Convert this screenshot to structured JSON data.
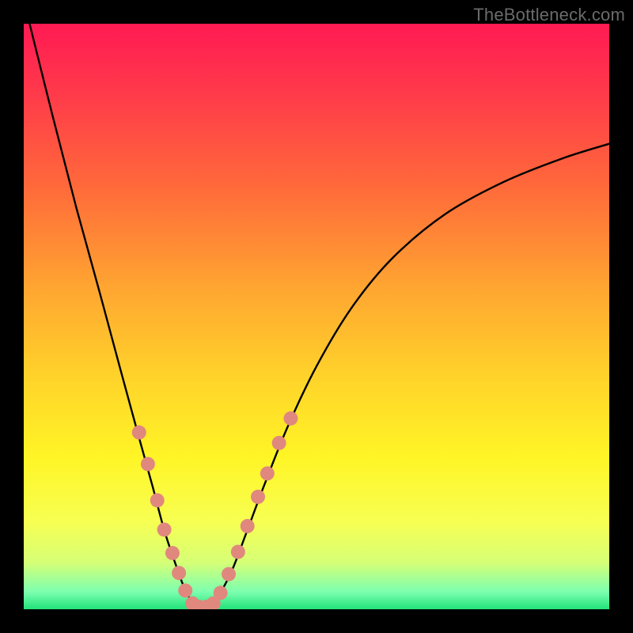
{
  "watermark": {
    "text": "TheBottleneck.com"
  },
  "chart_data": {
    "type": "line",
    "title": "",
    "xlabel": "",
    "ylabel": "",
    "xlim": [
      0,
      100
    ],
    "ylim": [
      0,
      100
    ],
    "grid": false,
    "legend": false,
    "gradient_stops": [
      {
        "offset": 0.0,
        "color": "#ff1a53"
      },
      {
        "offset": 0.12,
        "color": "#ff3a4a"
      },
      {
        "offset": 0.28,
        "color": "#ff6a3a"
      },
      {
        "offset": 0.45,
        "color": "#ffa531"
      },
      {
        "offset": 0.6,
        "color": "#ffd22a"
      },
      {
        "offset": 0.74,
        "color": "#fff526"
      },
      {
        "offset": 0.85,
        "color": "#f7ff52"
      },
      {
        "offset": 0.92,
        "color": "#d6ff76"
      },
      {
        "offset": 0.97,
        "color": "#7dffb0"
      },
      {
        "offset": 1.0,
        "color": "#22e27a"
      }
    ],
    "series": [
      {
        "name": "bottleneck-curve",
        "x": [
          1.0,
          5.0,
          9.0,
          13.0,
          16.5,
          19.5,
          22.0,
          24.0,
          26.0,
          27.5,
          29.2,
          30.8,
          33.0,
          35.5,
          38.0,
          41.0,
          45.0,
          50.0,
          56.0,
          63.0,
          72.0,
          82.0,
          92.0,
          100.0
        ],
        "values": [
          100.0,
          84.0,
          68.5,
          54.0,
          41.0,
          30.0,
          21.0,
          13.5,
          7.5,
          3.5,
          0.7,
          0.4,
          2.0,
          6.5,
          13.0,
          21.0,
          31.0,
          41.5,
          51.5,
          60.0,
          67.5,
          73.0,
          77.0,
          79.5
        ]
      }
    ],
    "scatter": {
      "name": "highlight-points",
      "color": "#e0887e",
      "radius": 9,
      "points": [
        {
          "x": 19.7,
          "y": 30.2
        },
        {
          "x": 21.2,
          "y": 24.8
        },
        {
          "x": 22.8,
          "y": 18.6
        },
        {
          "x": 24.0,
          "y": 13.6
        },
        {
          "x": 25.4,
          "y": 9.6
        },
        {
          "x": 26.5,
          "y": 6.2
        },
        {
          "x": 27.6,
          "y": 3.2
        },
        {
          "x": 28.8,
          "y": 1.0
        },
        {
          "x": 30.0,
          "y": 0.4
        },
        {
          "x": 31.2,
          "y": 0.4
        },
        {
          "x": 32.4,
          "y": 1.0
        },
        {
          "x": 33.6,
          "y": 2.8
        },
        {
          "x": 35.0,
          "y": 6.0
        },
        {
          "x": 36.6,
          "y": 9.8
        },
        {
          "x": 38.2,
          "y": 14.2
        },
        {
          "x": 40.0,
          "y": 19.2
        },
        {
          "x": 41.6,
          "y": 23.2
        },
        {
          "x": 43.6,
          "y": 28.4
        },
        {
          "x": 45.6,
          "y": 32.6
        }
      ]
    }
  }
}
